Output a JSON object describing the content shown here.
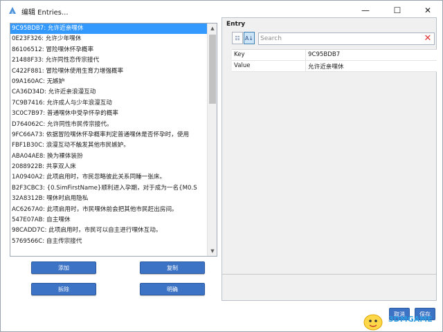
{
  "window": {
    "title": "编辑 Entries...",
    "controls": {
      "minimize": "—",
      "maximize": "☐",
      "close": "✕"
    }
  },
  "list": {
    "items": [
      "9C95BDB7: 允许近亲嘿休",
      "0E23F326: 允许少年嘿休",
      "86106512: 冒险嘿休怀孕概率",
      "21488F33: 允许同性恋传宗接代",
      "C422F881: 冒险嘿休使用生育力增强概率",
      "09A160AC: 无嫉妒",
      "CA36D34D: 允许近亲浪漫互动",
      "7C9B7416: 允许成人与少年浪漫互动",
      "3C0C7B97: 普通嘿休中受孕怀孕的概率",
      "D764062C: 允许同性市民传宗接代。",
      "9FC66A73: 依据冒险嘿休怀孕概率判定普通嘿休是否怀孕时，使用",
      "FBF1B30C: 浪漫互动不触发其他市民嫉妒。",
      "ABA04AE8: 换为裸体装扮",
      "2088922B: 共享双人床",
      "1A0940A2: 此项启用时，市民忽略彼此关系同睡一张床。",
      "B2F3CBC3: {0.SimFirstName}顺利进入孕期，对于成为一名{M0.S",
      "32A8312B: 嘿休时启用隐私",
      "AC6267A0: 此项启用时，市民嘿休前会把其他市民赶出房间。",
      "547E07AB: 自主嘿休",
      "98CADD7C: 此项启用时，市民可以自主进行嘿休互动。",
      "5769566C: 自主传宗接代"
    ],
    "selected_index": 0,
    "scroll_up": "▲",
    "scroll_down": "▼"
  },
  "buttons": {
    "add": "添加",
    "copy": "复制",
    "delete": "拆除",
    "confirm": "明确",
    "cancel": "取消",
    "save": "保存"
  },
  "entry": {
    "header": "Entry",
    "search_placeholder": "Search",
    "clear": "✕",
    "sort_categorized": "☷",
    "sort_alphabetical": "A↓",
    "rows": [
      {
        "key": "Key",
        "value": "9C95BDB7"
      },
      {
        "key": "Value",
        "value": "允许近亲嘿休"
      }
    ]
  },
  "watermark": {
    "text": "3DMGAME"
  },
  "colors": {
    "accent": "#3d73c4",
    "selection": "#3399ff",
    "clear_icon": "#e33030"
  }
}
